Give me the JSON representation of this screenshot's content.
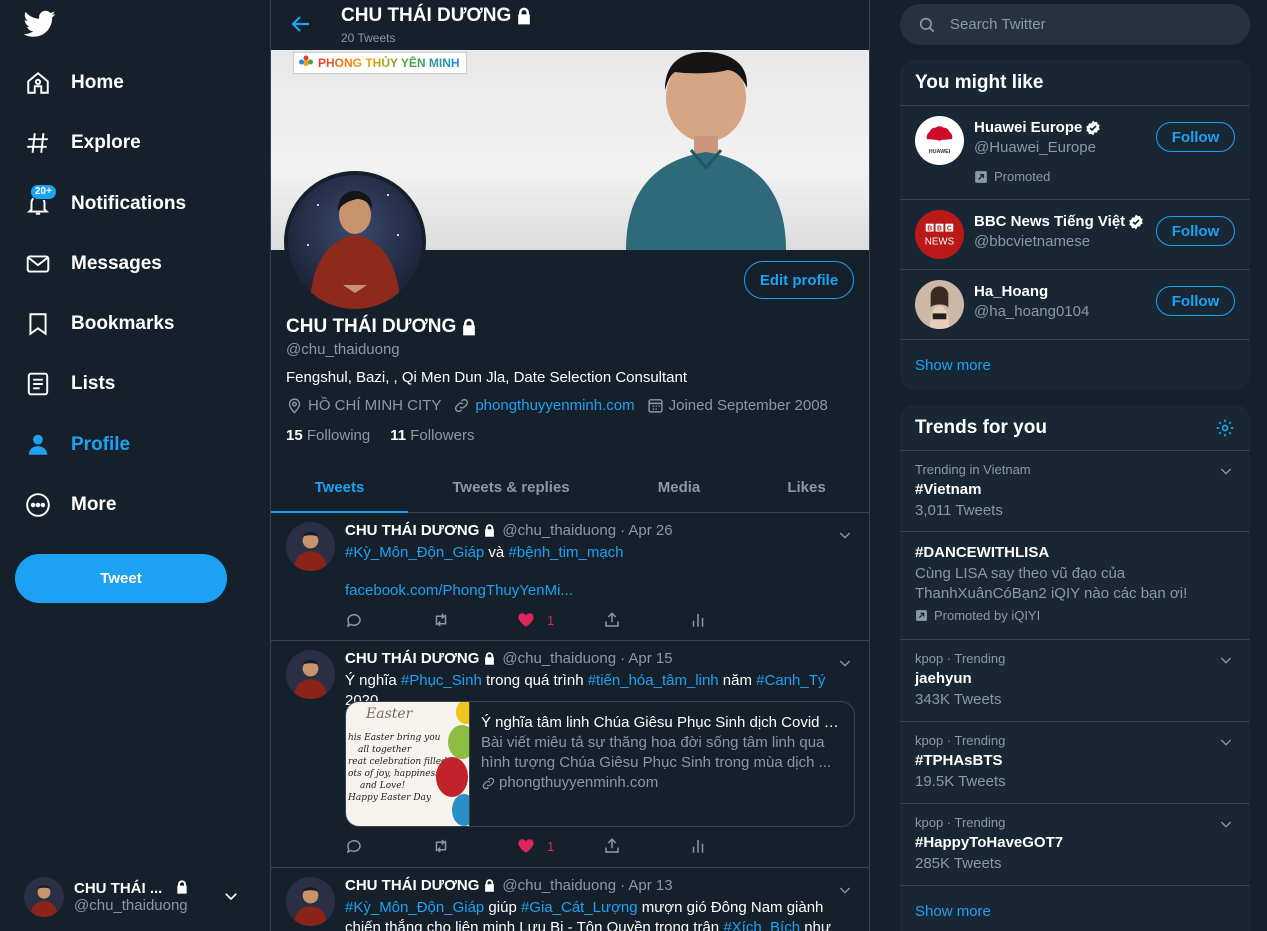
{
  "nav": {
    "items": [
      {
        "label": "Home"
      },
      {
        "label": "Explore"
      },
      {
        "label": "Notifications",
        "badge": "20+"
      },
      {
        "label": "Messages"
      },
      {
        "label": "Bookmarks"
      },
      {
        "label": "Lists"
      },
      {
        "label": "Profile"
      },
      {
        "label": "More"
      }
    ],
    "tweet_button": "Tweet",
    "account": {
      "name": "CHU THÁI ...",
      "handle": "@chu_thaiduong"
    }
  },
  "header": {
    "title": "CHU THÁI DƯƠNG",
    "subtitle": "20 Tweets"
  },
  "banner": {
    "brand": "PHONG THỦY YÊN MINH"
  },
  "profile": {
    "edit_button": "Edit profile",
    "name": "CHU THÁI DƯƠNG",
    "handle": "@chu_thaiduong",
    "bio": "Fengshul, Bazi, , Qi Men Dun Jla, Date Selection Consultant",
    "location": "HỒ CHÍ MINH CITY",
    "website": "phongthuyyenminh.com",
    "joined": "Joined September 2008",
    "following_count": "15",
    "following_label": "Following",
    "followers_count": "11",
    "followers_label": "Followers"
  },
  "tabs": [
    {
      "label": "Tweets",
      "active": true
    },
    {
      "label": "Tweets & replies"
    },
    {
      "label": "Media"
    },
    {
      "label": "Likes"
    }
  ],
  "tweets": [
    {
      "name": "CHU THÁI DƯƠNG",
      "handle": "@chu_thaiduong",
      "date": "· Apr 26",
      "parts": [
        {
          "text": "#Kỳ_Môn_Độn_Giáp",
          "link": true
        },
        {
          "text": " và "
        },
        {
          "text": "#bệnh_tim_mạch",
          "link": true
        }
      ],
      "link_line": "facebook.com/PhongThuyYenMi...",
      "likes": "1"
    },
    {
      "name": "CHU THÁI DƯƠNG",
      "handle": "@chu_thaiduong",
      "date": "· Apr 15",
      "parts": [
        {
          "text": "Ý nghĩa "
        },
        {
          "text": "#Phục_Sinh",
          "link": true
        },
        {
          "text": " trong quá trình "
        },
        {
          "text": "#tiến_hóa_tâm_linh",
          "link": true
        },
        {
          "text": " năm "
        },
        {
          "text": "#Canh_Tý",
          "link": true
        },
        {
          "text": " 2020"
        }
      ],
      "card": {
        "title": "Ý nghĩa tâm linh Chúa Giêsu Phục Sinh dịch Covid 19...",
        "description": "Bài viết miêu tả sự thăng hoa đời sống tâm linh qua hình tượng Chúa Giêsu Phục Sinh trong mùa dịch ...",
        "domain": "phongthuyyenminh.com",
        "image_text": [
          "Easter",
          "his Easter bring you",
          "all together",
          "reat celebration filled",
          "ots of joy, happiness,",
          "and Love!",
          "Happy Easter Day"
        ]
      },
      "likes": "1"
    },
    {
      "name": "CHU THÁI DƯƠNG",
      "handle": "@chu_thaiduong",
      "date": "· Apr 13",
      "parts": [
        {
          "text": "#Kỳ_Môn_Độn_Giáp",
          "link": true
        },
        {
          "text": " giúp "
        },
        {
          "text": "#Gia_Cát_Lượng",
          "link": true
        },
        {
          "text": " mượn gió Đông Nam giành chiến thắng cho liên minh Lưu Bị - Tôn Quyền trong trận "
        },
        {
          "text": "#Xích_Bích",
          "link": true
        },
        {
          "text": " như thế nào ?"
        }
      ]
    }
  ],
  "search": {
    "placeholder": "Search Twitter"
  },
  "who_to_follow": {
    "title": "You might like",
    "users": [
      {
        "name": "Huawei Europe",
        "handle": "@Huawei_Europe",
        "verified": true,
        "promoted": "Promoted",
        "button": "Follow"
      },
      {
        "name": "BBC News Tiếng Việt",
        "handle": "@bbcvietnamese",
        "verified": true,
        "button": "Follow"
      },
      {
        "name": "Ha_Hoang",
        "handle": "@ha_hoang0104",
        "button": "Follow"
      }
    ],
    "show_more": "Show more"
  },
  "trends": {
    "title": "Trends for you",
    "items": [
      {
        "context": "Trending in Vietnam",
        "name": "#Vietnam",
        "count": "3,011 Tweets"
      },
      {
        "name": "#DANCEWITHLISA",
        "description": "Cùng LISA say theo vũ đạo của ThanhXuânCóBạn2 iQIY nào các bạn ơi!",
        "promoted": "Promoted by iQIYI"
      },
      {
        "context": "kpop · Trending",
        "name": "jaehyun",
        "count": "343K Tweets"
      },
      {
        "context": "kpop · Trending",
        "name": "#TPHAsBTS",
        "count": "19.5K Tweets"
      },
      {
        "context": "kpop · Trending",
        "name": "#HappyToHaveGOT7",
        "count": "285K Tweets"
      }
    ],
    "show_more": "Show more"
  },
  "colors": {
    "background": "#15202b",
    "panel": "#192734",
    "accent": "#1da1f2",
    "muted": "#8899a6",
    "like": "#e0245e",
    "border": "#38444d"
  }
}
